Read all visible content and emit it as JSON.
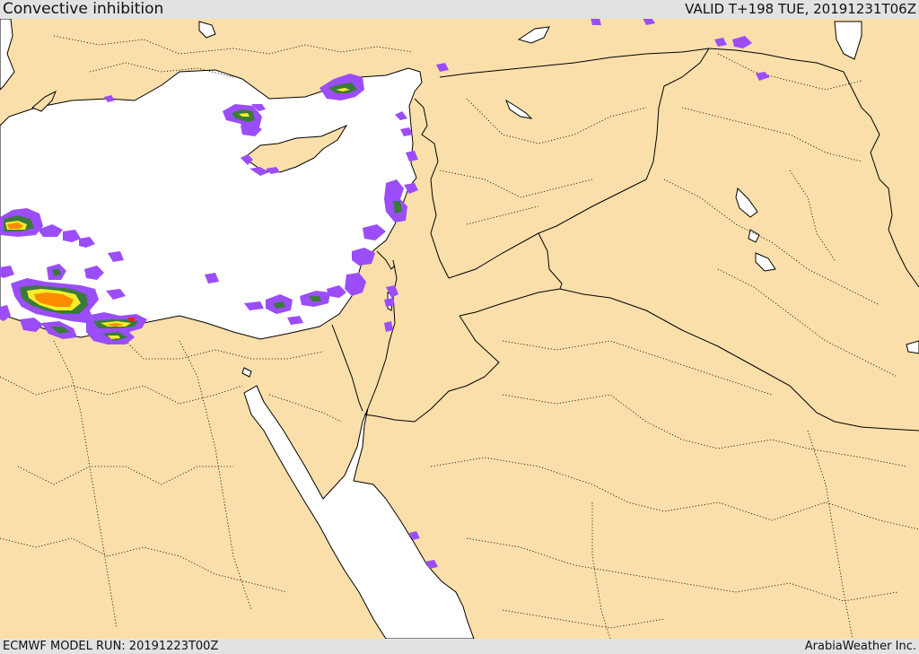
{
  "header": {
    "title": "Convective inhibition",
    "valid": "VALID T+198 TUE, 20191231T06Z"
  },
  "footer": {
    "model_run": "ECMWF MODEL RUN: 20191223T00Z",
    "credit": "ArabiaWeather Inc."
  },
  "map": {
    "land_color": "#fbdfaa",
    "sea_color": "#ffffff",
    "contour_colors": [
      "#9b4dfa",
      "#3c7a3a",
      "#f7ee28",
      "#fb8c00",
      "#e8231a"
    ]
  }
}
